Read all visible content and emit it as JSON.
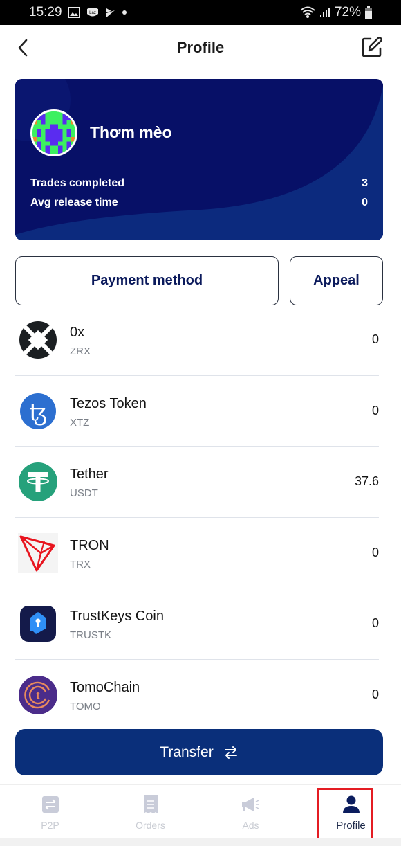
{
  "status_bar": {
    "time": "15:29",
    "notification_icons": [
      "gallery-icon",
      "lazada-icon",
      "task-icon",
      "dot-icon"
    ],
    "battery": "72%",
    "system_icons": [
      "wifi-icon",
      "signal-icon",
      "battery-icon"
    ]
  },
  "header": {
    "title": "Profile",
    "back_icon": "chevron-left-icon",
    "edit_icon": "edit-icon"
  },
  "profile": {
    "username": "Thơm mèo",
    "stats": [
      {
        "label": "Trades completed",
        "value": "3"
      },
      {
        "label": "Avg release time",
        "value": "0"
      }
    ]
  },
  "actions": {
    "payment_method": "Payment method",
    "appeal": "Appeal"
  },
  "tokens": [
    {
      "name": "0x",
      "symbol": "ZRX",
      "balance": "0",
      "icon": "zrx-icon"
    },
    {
      "name": "Tezos Token",
      "symbol": "XTZ",
      "balance": "0",
      "icon": "tezos-icon"
    },
    {
      "name": "Tether",
      "symbol": "USDT",
      "balance": "37.6",
      "icon": "tether-icon"
    },
    {
      "name": "TRON",
      "symbol": "TRX",
      "balance": "0",
      "icon": "tron-icon"
    },
    {
      "name": "TrustKeys Coin",
      "symbol": "TRUSTK",
      "balance": "0",
      "icon": "trustkeys-icon"
    },
    {
      "name": "TomoChain",
      "symbol": "TOMO",
      "balance": "0",
      "icon": "tomochain-icon"
    }
  ],
  "transfer": {
    "label": "Transfer",
    "icon": "swap-arrows-icon"
  },
  "bottom_nav": {
    "items": [
      {
        "label": "P2P",
        "icon": "p2p-icon",
        "active": false
      },
      {
        "label": "Orders",
        "icon": "receipt-icon",
        "active": false
      },
      {
        "label": "Ads",
        "icon": "megaphone-icon",
        "active": false
      },
      {
        "label": "Profile",
        "icon": "person-icon",
        "active": true
      }
    ]
  },
  "colors": {
    "card_bg": "#071067",
    "primary": "#0a2f7a",
    "button_text": "#0b1a5c",
    "highlight": "#e41c23",
    "tether_green": "#26a17b",
    "tezos_blue": "#2c7df7",
    "tron_red": "#e8141e",
    "tomo_purple": "#4b2c8a"
  }
}
